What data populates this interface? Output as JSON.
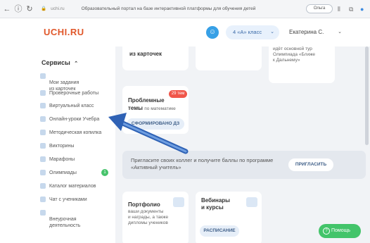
{
  "browser": {
    "host": "uchi.ru",
    "page_title": "Образовательный портал на базе интерактивной платформы для обучения детей",
    "account_pill": "Ольга"
  },
  "header": {
    "logo": "UCHI.RU",
    "class_select": "4 «А» класс",
    "user_name": "Екатерина С."
  },
  "sidebar": {
    "title": "Сервисы",
    "items": [
      {
        "label": "Мои задания\nиз карточек"
      },
      {
        "label": "Проверочные работы"
      },
      {
        "label": "Виртуальный класс"
      },
      {
        "label": "Онлайн-уроки Учебра"
      },
      {
        "label": "Методическая копилка"
      },
      {
        "label": "Викторины"
      },
      {
        "label": "Марафоны"
      },
      {
        "label": "Олимпиады",
        "badge": "1"
      },
      {
        "label": "Каталог материалов"
      },
      {
        "label": "Чат с учениками"
      },
      {
        "label": "Внеурочная\nдеятельность"
      }
    ]
  },
  "cards": {
    "top1_title": "из карточек",
    "top3_text": "идёт основной тур\nОлимпиада «Ближе\nк Дальнему»",
    "problem_badge": "29 тем",
    "problem_title": "Проблемные",
    "problem_title2": "темы",
    "problem_sub": "по математике",
    "problem_button": "СФОРМИРОВАНО ДЗ",
    "invite_text": "Пригласите своих коллег и получите баллы по программе «Активный учитель»",
    "invite_button": "ПРИГЛАСИТЬ",
    "portfolio_title": "Портфолио",
    "portfolio_sub": "ваши документы\nи награды, а также\nдипломы учеников",
    "webinars_title": "Вебинары\nи курсы",
    "webinars_button": "РАСПИСАНИЕ"
  },
  "help_button": "Помощь",
  "colors": {
    "brand": "#e0572a",
    "accent": "#37a0e6",
    "help": "#43c46a",
    "badge": "#f0564a",
    "arrow": "#2f62b5"
  },
  "icons": [
    "back-icon",
    "info-icon",
    "reload-icon",
    "lock-icon",
    "chevron-down-icon",
    "chevron-up-icon",
    "question-icon",
    "arrow-annotation"
  ]
}
